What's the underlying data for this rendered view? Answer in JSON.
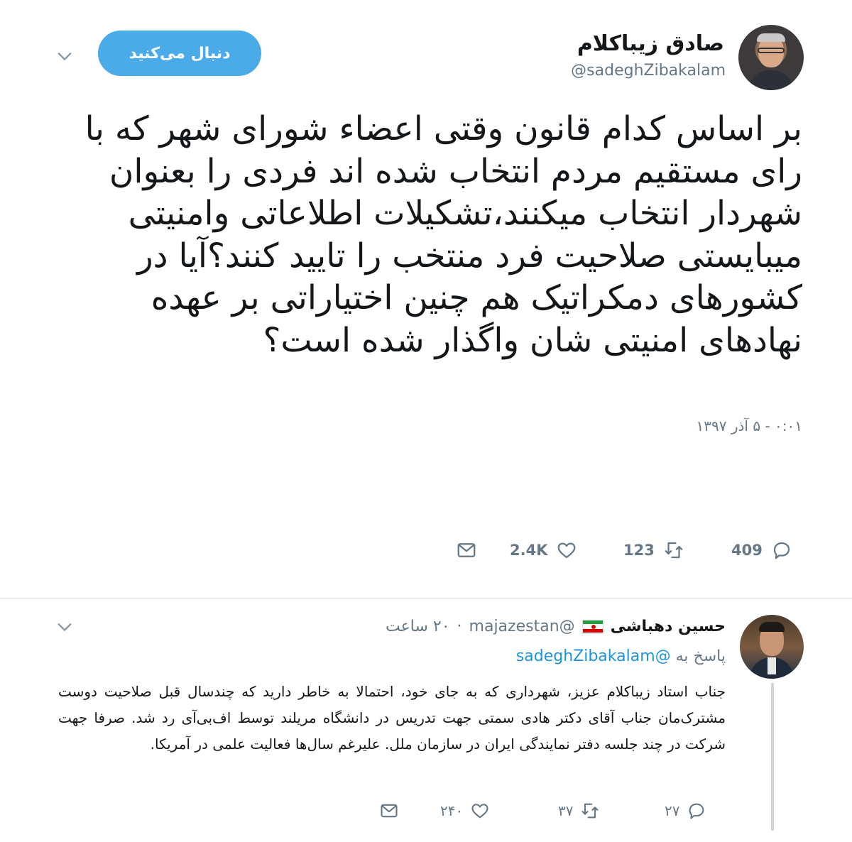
{
  "main_tweet": {
    "author_name": "صادق زیباکلام",
    "author_handle": "@sadeghZibakalam",
    "follow_label": "دنبال می‌کنید",
    "text": "بر اساس کدام قانون وقتی اعضاء شورای شهر که با رای مستقیم مردم انتخاب شده اند فردی را بعنوان شهردار انتخاب میکنند،تشکیلات اطلاعاتی وامنیتی میبایستی صلاحیت فرد منتخب را تایید کنند؟آیا در کشورهای دمکراتیک هم چنین اختیاراتی بر عهده نهادهای امنیتی شان واگذار شده است؟",
    "timestamp": "۰:۰۱ - ۵ آذر ۱۳۹۷",
    "actions": {
      "replies": "409",
      "retweets": "123",
      "likes": "2.4K"
    }
  },
  "reply_tweet": {
    "author_name": "حسین دهباشی",
    "author_handle": "@majazestan",
    "dot": "·",
    "time": "۲۰ ساعت",
    "replying_prefix": "پاسخ به",
    "replying_to": "@sadeghZibakalam",
    "text": "جناب استاد زیباکلام عزیز، شهرداری که به جای خود، احتمالا به خاطر دارید که چندسال قبل صلاحیت دوست مشترک‌مان جناب آقای دکتر هادی سمتی جهت تدریس در دانشگاه مریلند توسط اف‌بی‌آی رد شد. صرفا جهت شرکت در چند جلسه دفتر نمایندگی ایران در سازمان ملل. علیرغم سال‌ها فعالیت علمی در آمریکا.",
    "actions": {
      "replies": "۲۷",
      "retweets": "۳۷",
      "likes": "۲۴۰"
    }
  },
  "icons": [
    "chevron-down-icon",
    "reply-icon",
    "retweet-icon",
    "like-icon",
    "message-icon",
    "iran-flag-icon"
  ],
  "colors": {
    "accent": "#4aabe8",
    "link": "#1b95e0",
    "muted": "#657786",
    "text": "#14171a"
  }
}
